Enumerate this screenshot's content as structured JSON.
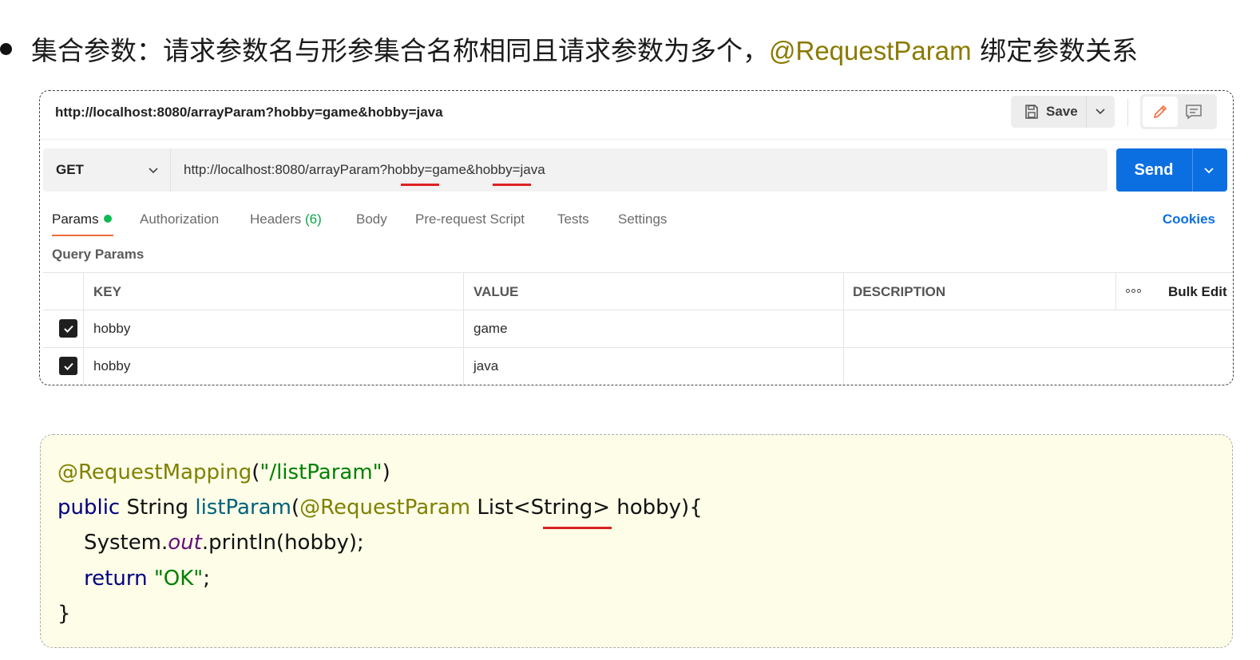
{
  "heading": {
    "text_before": "集合参数：请求参数名与形参集合名称相同且请求参数为多个，",
    "highlight": "@RequestParam",
    "text_after": " 绑定参数关系"
  },
  "postman": {
    "request_title": "http://localhost:8080/arrayParam?hobby=game&hobby=java",
    "save_label": "Save",
    "method": "GET",
    "url": "http://localhost:8080/arrayParam?hobby=game&hobby=java",
    "send_label": "Send",
    "tabs": {
      "params": "Params",
      "authorization": "Authorization",
      "headers": "Headers",
      "headers_count": "(6)",
      "body": "Body",
      "prerequest": "Pre-request Script",
      "tests": "Tests",
      "settings": "Settings"
    },
    "cookies_label": "Cookies",
    "query_params_label": "Query Params",
    "table": {
      "headers": {
        "key": "KEY",
        "value": "VALUE",
        "description": "DESCRIPTION",
        "bulk_edit": "Bulk Edit"
      },
      "rows": [
        {
          "checked": true,
          "key": "hobby",
          "value": "game",
          "description": ""
        },
        {
          "checked": true,
          "key": "hobby",
          "value": "java",
          "description": ""
        }
      ]
    }
  },
  "code": {
    "l1": {
      "annotation": "@RequestMapping",
      "p_open": "(",
      "string": "\"/listParam\"",
      "p_close": ")"
    },
    "l2": {
      "kw": "public",
      "type": " String ",
      "method": "listParam",
      "p_open": "(",
      "annotation": "@RequestParam",
      "rest": " List<String> hobby){"
    },
    "l3": {
      "pre": "    System.",
      "field": "out",
      "post": ".println(hobby);"
    },
    "l4": {
      "indent": "    ",
      "kw": "return",
      "space": " ",
      "string": "\"OK\"",
      "end": ";"
    },
    "l5": {
      "text": "}"
    }
  },
  "colors": {
    "send": "#0c6fe1",
    "annotation": "#808000",
    "keyword": "#000080",
    "string": "#008000",
    "underline": "#e02020",
    "code_bg": "#fdfde8"
  }
}
